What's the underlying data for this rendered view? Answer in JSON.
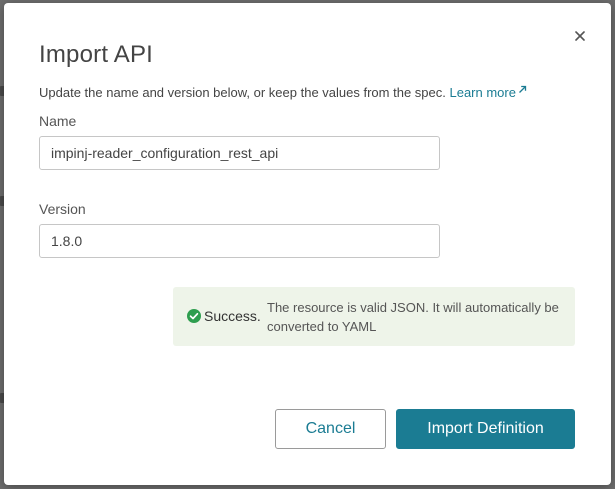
{
  "dialog": {
    "title": "Import API",
    "close_icon": "close-icon",
    "subtitle": "Update the name and version below, or keep the values from the spec.",
    "learn_more_label": "Learn more",
    "learn_more_icon": "external-link-icon"
  },
  "form": {
    "name_label": "Name",
    "name_value": "impinj-reader_configuration_rest_api",
    "version_label": "Version",
    "version_value": "1.8.0"
  },
  "alert": {
    "icon": "check-circle-icon",
    "title": "Success.",
    "message": "The resource is valid JSON. It will automatically be converted to YAML",
    "background": "#eef4e9",
    "icon_color": "#2e9e4f"
  },
  "actions": {
    "cancel_label": "Cancel",
    "import_label": "Import Definition",
    "accent": "#1b7c93"
  }
}
